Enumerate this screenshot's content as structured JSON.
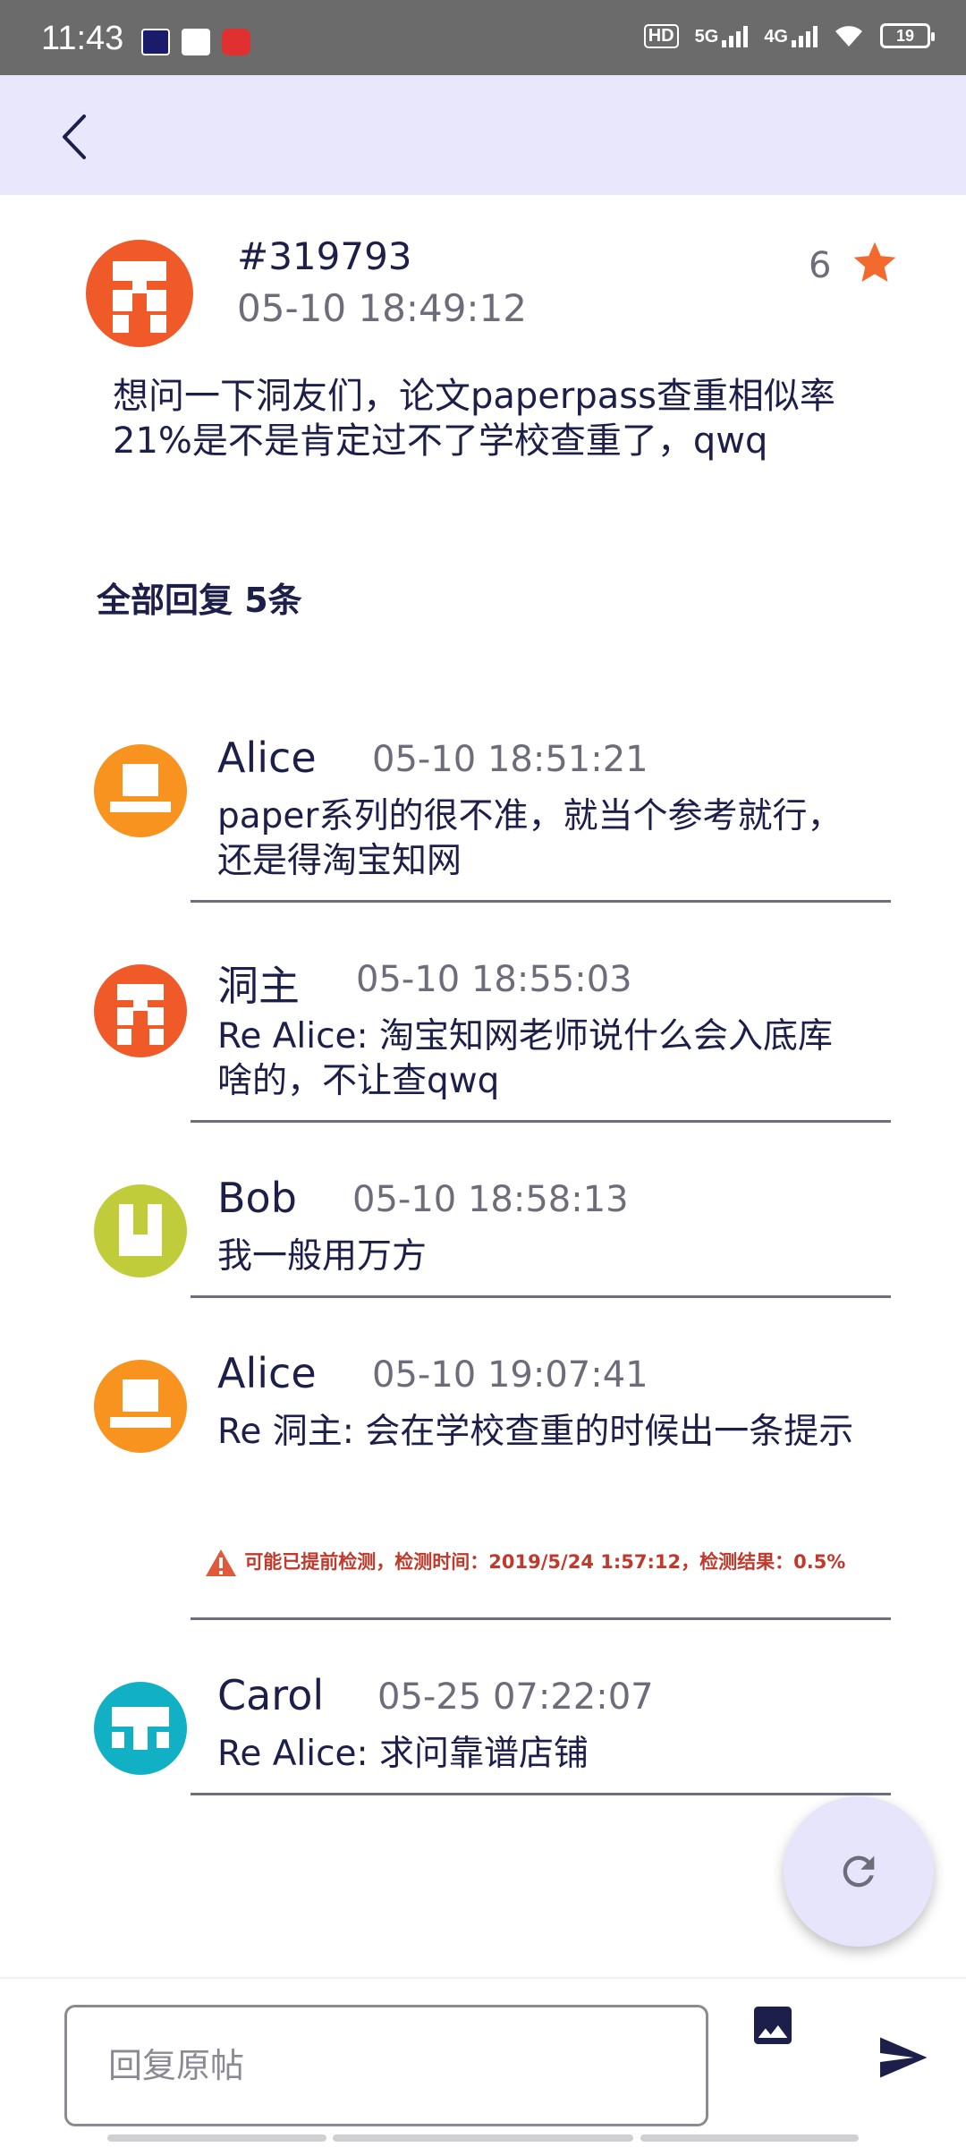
{
  "status_bar": {
    "time": "11:43",
    "battery": "19",
    "network_5g": "5G",
    "network_4g": "4G",
    "hd": "HD"
  },
  "colors": {
    "accent": "#1c1f4a",
    "appbar_bg": "#e9e7fb",
    "star": "#f26a2e",
    "avatar_red": "#f05a28",
    "avatar_orange": "#f7931e",
    "avatar_lime": "#c0cc3a",
    "avatar_cyan": "#12b0c4"
  },
  "icons": {
    "back": "chevron-left-icon",
    "star": "star-icon",
    "refresh": "refresh-icon",
    "image": "image-icon",
    "send": "send-icon"
  },
  "post": {
    "id": "#319793",
    "time": "05-10 18:49:12",
    "star_count": "6",
    "body": "想问一下洞友们，论文paperpass查重相似率21%是不是肯定过不了学校查重了，qwq"
  },
  "replies_header": "全部回复 5条",
  "replies": [
    {
      "name": "Alice",
      "time": "05-10 18:51:21",
      "text": "paper系列的很不准，就当个参考就行，还是得淘宝知网"
    },
    {
      "name": "洞主",
      "time": "05-10 18:55:03",
      "text": "Re Alice: 淘宝知网老师说什么会入底库啥的，不让查qwq"
    },
    {
      "name": "Bob",
      "time": "05-10 18:58:13",
      "text": "我一般用万方"
    },
    {
      "name": "Alice",
      "time": "05-10 19:07:41",
      "text": "Re 洞主: 会在学校查重的时候出一条提示",
      "image_text": "可能已提前检测，检测时间：2019/5/24 1:57:12，检测结果：0.5%"
    },
    {
      "name": "Carol",
      "time": "05-25 07:22:07",
      "text": "Re Alice: 求问靠谱店铺"
    }
  ],
  "input": {
    "placeholder": "回复原帖"
  }
}
